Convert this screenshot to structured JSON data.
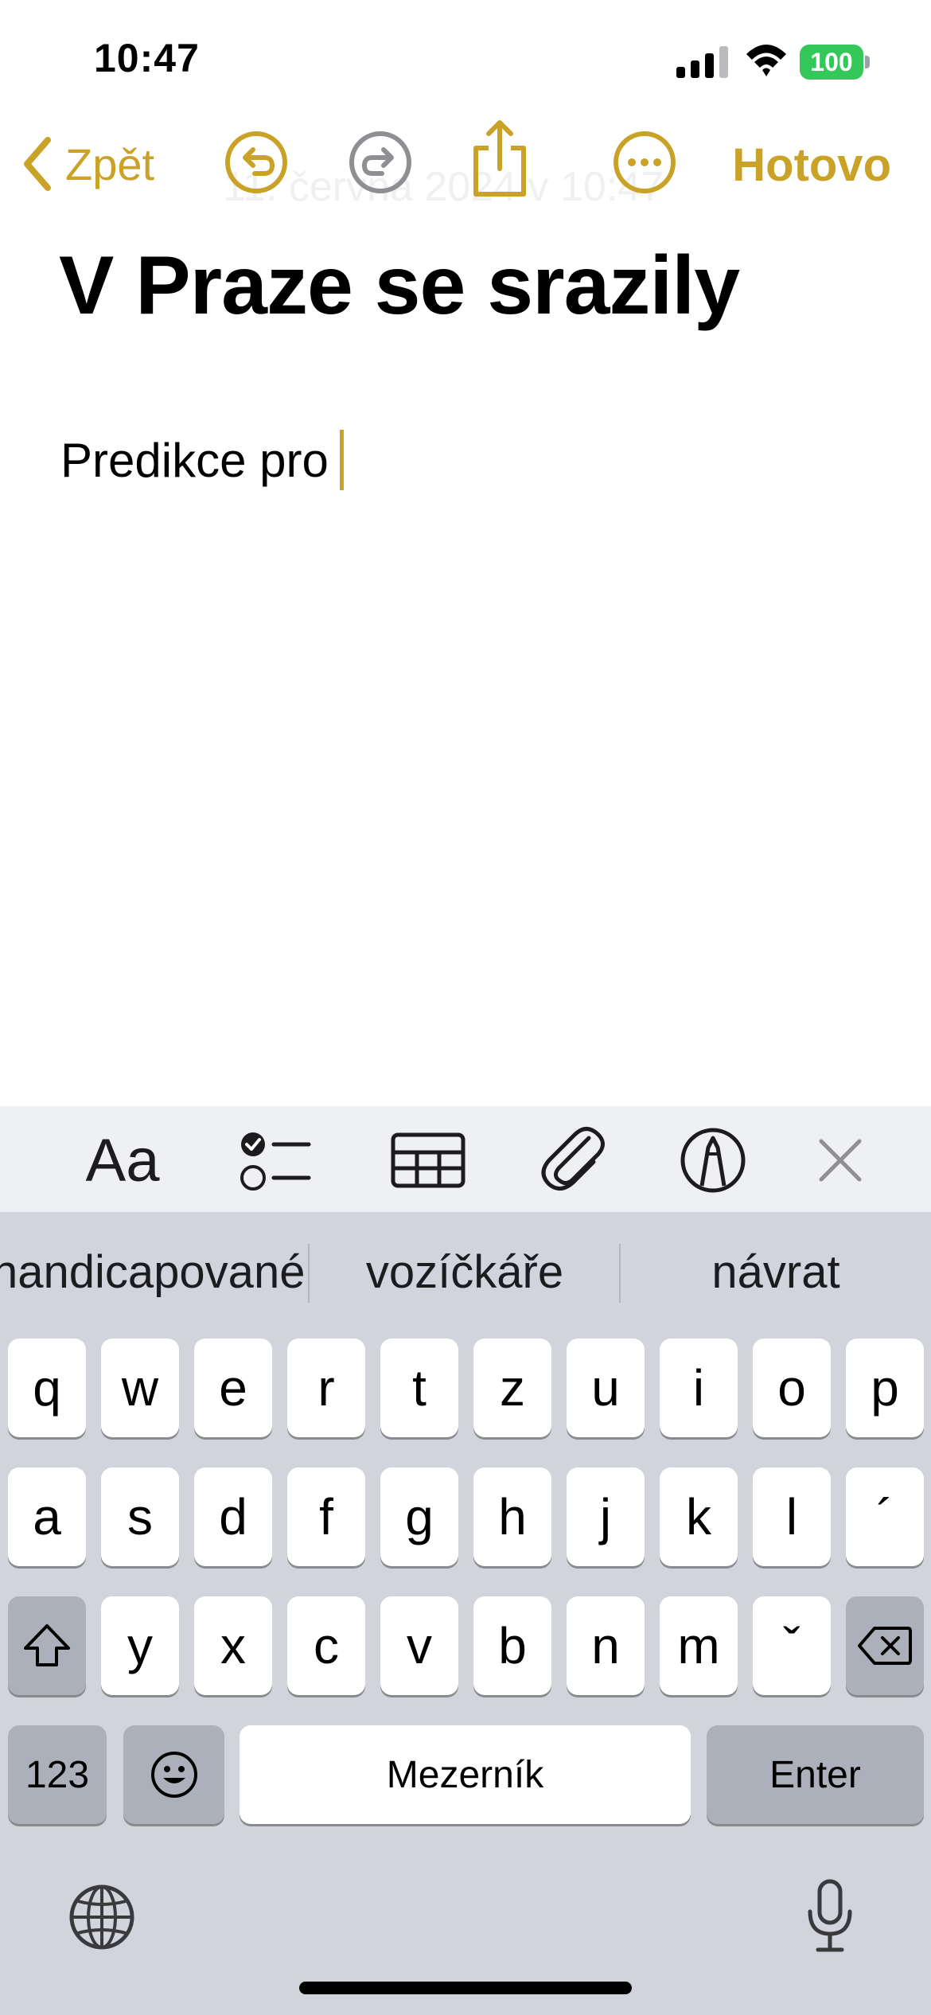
{
  "status_bar": {
    "time": "10:47",
    "battery": "100",
    "battery_color": "#34c759"
  },
  "nav": {
    "back_label": "Zpět",
    "done_label": "Hotovo",
    "ghost_date": "11. června 2024 v 10:47",
    "accent_color": "#c9a227",
    "icons": [
      "undo-icon",
      "redo-icon",
      "share-icon",
      "more-icon"
    ]
  },
  "note": {
    "title": "V Praze se srazily",
    "body": "Predikce pro"
  },
  "format_toolbar": {
    "text_style_label": "Aa",
    "icons": [
      "checklist-icon",
      "table-icon",
      "attachment-icon",
      "markup-icon",
      "close-icon"
    ]
  },
  "keyboard": {
    "suggestions": [
      "handicapované",
      "vozíčkáře",
      "návrat"
    ],
    "row1": [
      "q",
      "w",
      "e",
      "r",
      "t",
      "z",
      "u",
      "i",
      "o",
      "p"
    ],
    "row2": [
      "a",
      "s",
      "d",
      "f",
      "g",
      "h",
      "j",
      "k",
      "l",
      "´"
    ],
    "row3": [
      "y",
      "x",
      "c",
      "v",
      "b",
      "n",
      "m",
      "ˇ"
    ],
    "numbers_label": "123",
    "space_label": "Mezerník",
    "enter_label": "Enter"
  }
}
